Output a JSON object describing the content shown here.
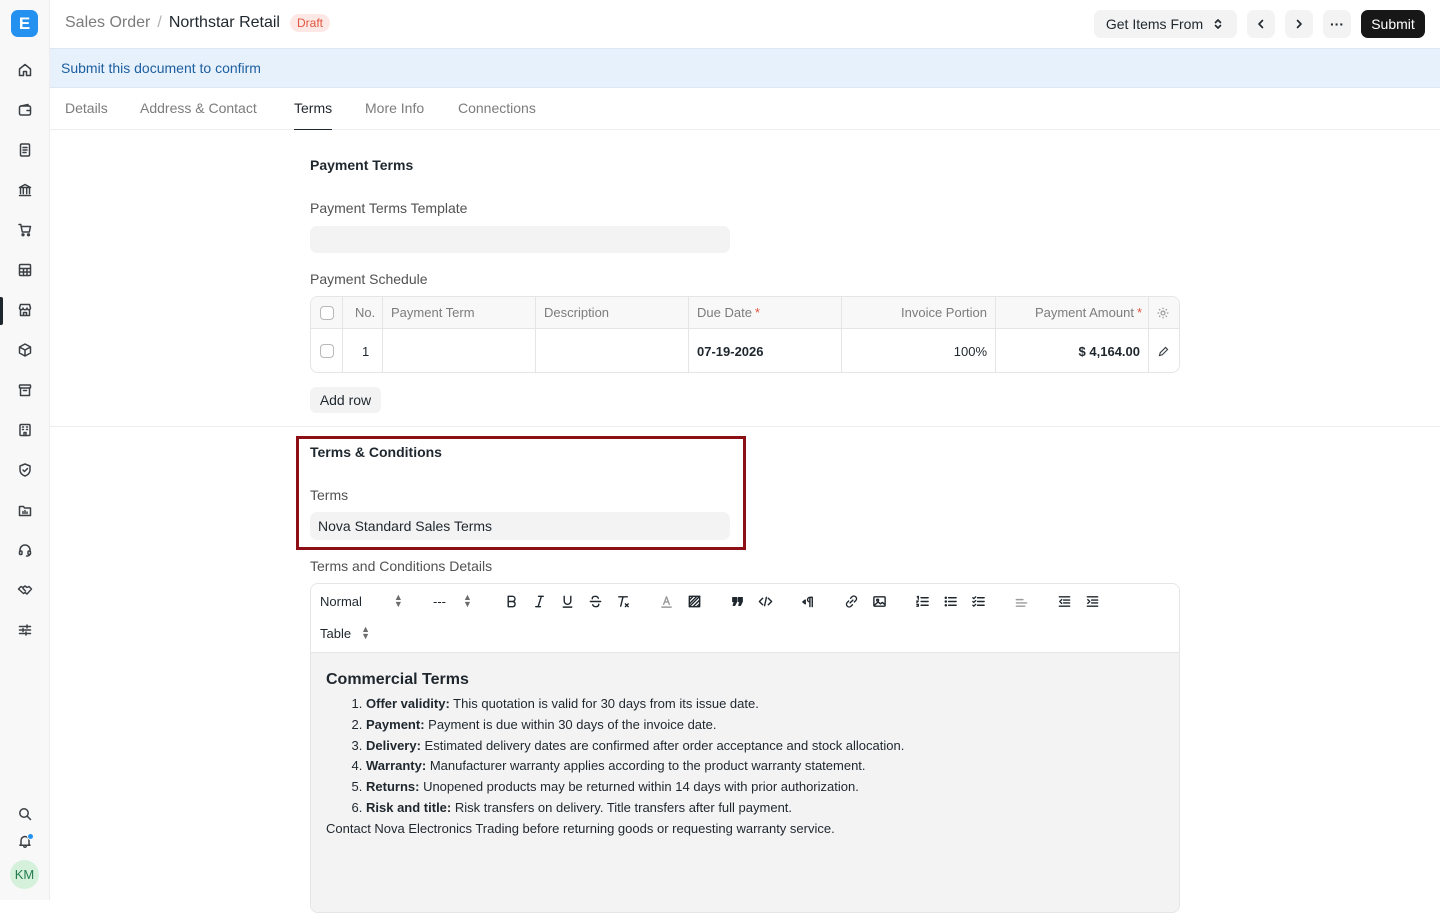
{
  "app": {
    "logo_letter": "E"
  },
  "user": {
    "initials": "KM"
  },
  "breadcrumb": {
    "parent": "Sales Order",
    "separator": "/",
    "current": "Northstar Retail"
  },
  "status": {
    "label": "Draft",
    "color": "#e0553f"
  },
  "toolbar": {
    "get_items_label": "Get Items From",
    "more_label": "···",
    "submit_label": "Submit"
  },
  "banner": {
    "text": "Submit this document to confirm"
  },
  "tabs": [
    {
      "label": "Details"
    },
    {
      "label": "Address & Contact"
    },
    {
      "label": "Terms",
      "active": true
    },
    {
      "label": "More Info"
    },
    {
      "label": "Connections"
    }
  ],
  "payment_terms": {
    "section_title": "Payment Terms",
    "template_label": "Payment Terms Template",
    "template_value": "",
    "schedule_label": "Payment Schedule",
    "columns": [
      "No.",
      "Payment Term",
      "Description",
      "Due Date",
      "Invoice Portion",
      "Payment Amount"
    ],
    "required_mark": "*",
    "rows": [
      {
        "no": "1",
        "payment_term": "",
        "description": "",
        "due_date": "07-19-2026",
        "invoice_portion": "100%",
        "payment_amount": "$ 4,164.00"
      }
    ],
    "add_row_label": "Add row"
  },
  "terms_conditions": {
    "section_title": "Terms & Conditions",
    "terms_label": "Terms",
    "terms_value": "Nova Standard Sales Terms",
    "details_label": "Terms and Conditions Details"
  },
  "editor_toolbar": {
    "paragraph_style": "Normal",
    "font_size": "---",
    "table_label": "Table"
  },
  "editor_content": {
    "heading": "Commercial Terms",
    "items": [
      {
        "term": "Offer validity:",
        "text": " This quotation is valid for 30 days from its issue date."
      },
      {
        "term": "Payment:",
        "text": " Payment is due within 30 days of the invoice date."
      },
      {
        "term": "Delivery:",
        "text": " Estimated delivery dates are confirmed after order acceptance and stock allocation."
      },
      {
        "term": "Warranty:",
        "text": " Manufacturer warranty applies according to the product warranty statement."
      },
      {
        "term": "Returns:",
        "text": " Unopened products may be returned within 14 days with prior authorization."
      },
      {
        "term": "Risk and title:",
        "text": " Risk transfers on delivery. Title transfers after full payment."
      }
    ],
    "footer": "Contact Nova Electronics Trading before returning goods or requesting warranty service."
  },
  "colors": {
    "accent": "#2490ef",
    "highlight_border": "#8b0f14",
    "banner_bg": "#e6f1fc"
  }
}
